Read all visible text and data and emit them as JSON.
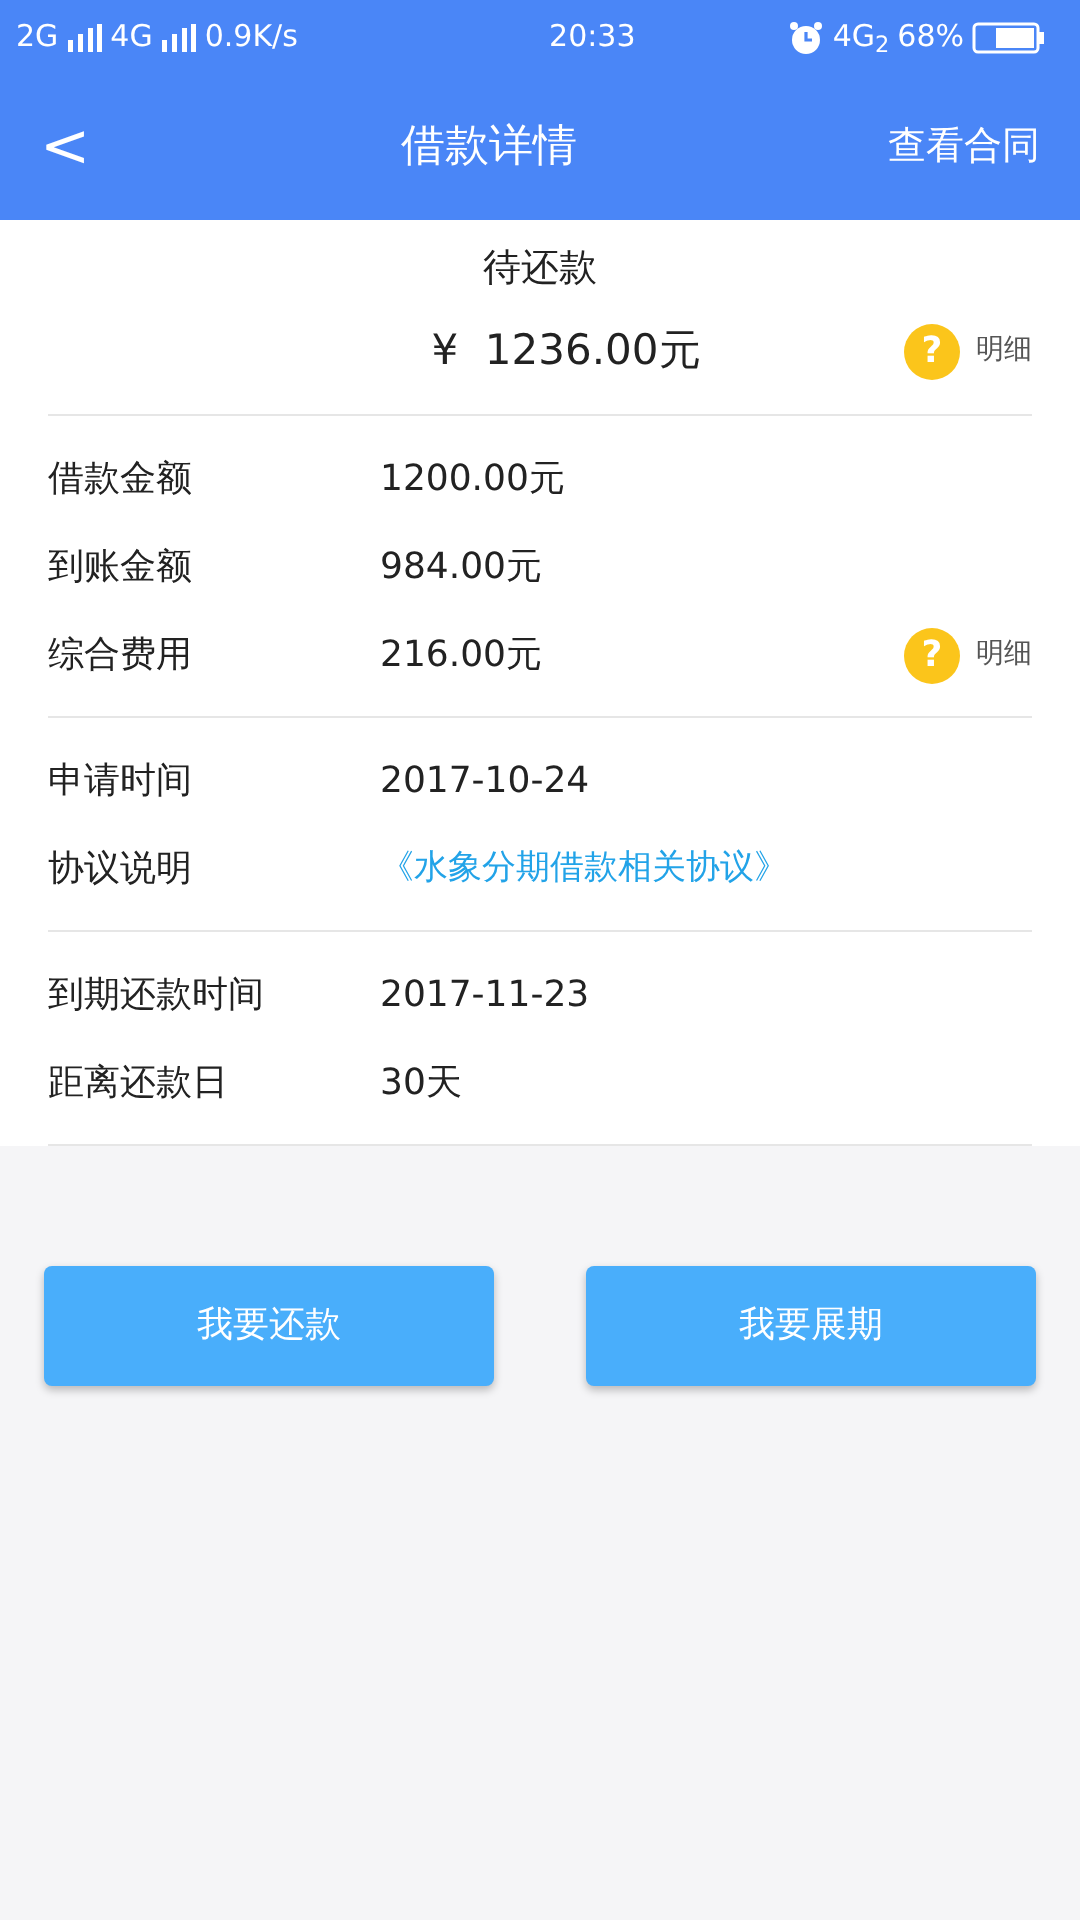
{
  "status_bar": {
    "network_1": "2G",
    "network_2": "4G",
    "speed": "0.9K/s",
    "time": "20:33",
    "network_3": "4G$_{2}$",
    "battery": "68%"
  },
  "nav": {
    "back": "<",
    "title": "借款详情",
    "action": "查看合同"
  },
  "summary": {
    "title": "待还款",
    "amount": "¥  1236.00元",
    "help": "?",
    "detail": "明细"
  },
  "sections": [
    {
      "rows": [
        {
          "kind": "value",
          "label": "借款金额",
          "value": "1200.00元"
        },
        {
          "kind": "value",
          "label": "到账金额",
          "value": "984.00元"
        },
        {
          "kind": "value",
          "label": "综合费用",
          "value": "216.00元",
          "help": "?",
          "detail": "明细"
        }
      ]
    },
    {
      "rows": [
        {
          "kind": "value",
          "label": "申请时间",
          "value": "2017-10-24"
        },
        {
          "kind": "link",
          "label": "协议说明",
          "value": "《水象分期借款相关协议》"
        }
      ]
    },
    {
      "rows": [
        {
          "kind": "value",
          "label": "到期还款时间",
          "value": "2017-11-23"
        },
        {
          "kind": "value",
          "label": "距离还款日",
          "value": "30天"
        }
      ]
    }
  ],
  "buttons": [
    "我要还款",
    "我要展期"
  ]
}
